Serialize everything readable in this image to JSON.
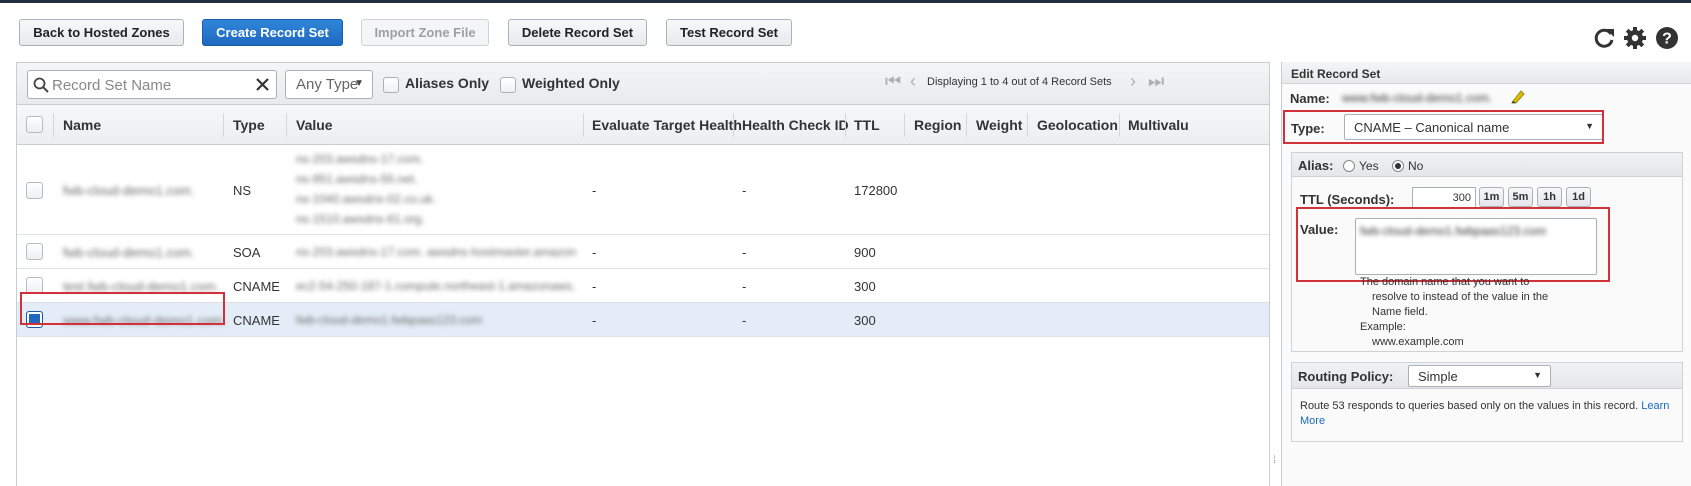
{
  "toolbar": {
    "back_label": "Back to Hosted Zones",
    "create_label": "Create Record Set",
    "import_label": "Import Zone File",
    "delete_label": "Delete Record Set",
    "test_label": "Test Record Set"
  },
  "filter": {
    "search_placeholder": "Record Set Name",
    "type_select": "Any Type",
    "aliases_only": "Aliases Only",
    "weighted_only": "Weighted Only",
    "pager_text": "Displaying 1 to 4 out of 4 Record Sets"
  },
  "columns": [
    "Name",
    "Type",
    "Value",
    "Evaluate Target Health",
    "Health Check ID",
    "TTL",
    "Region",
    "Weight",
    "Geolocation",
    "Multivalu"
  ],
  "rows": [
    {
      "name": "fwb-cloud-demo1.com.",
      "type": "NS",
      "values": [
        "ns-203.awsdns-17.com.",
        "ns-951.awsdns-55.net.",
        "ns-1040.awsdns-02.co.uk.",
        "ns-1510.awsdns-61.org."
      ],
      "evaluate": "-",
      "health": "-",
      "ttl": "172800"
    },
    {
      "name": "fwb-cloud-demo1.com.",
      "type": "SOA",
      "values": [
        "ns-203.awsdns-17.com. awsdns-hostmaster.amazon"
      ],
      "evaluate": "-",
      "health": "-",
      "ttl": "900"
    },
    {
      "name": "test.fwb-cloud-demo1.com.",
      "type": "CNAME",
      "values": [
        "ec2-54-250-187-1.compute.northeast-1.amazonaws.com"
      ],
      "evaluate": "-",
      "health": "-",
      "ttl": "300"
    },
    {
      "name": "www.fwb-cloud-demo1.com.",
      "type": "CNAME",
      "values": [
        "fwb-cloud-demo1.fwbpaas123.com"
      ],
      "evaluate": "-",
      "health": "-",
      "ttl": "300"
    }
  ],
  "edit": {
    "header": "Edit Record Set",
    "name_label": "Name:",
    "name_value": "www.fwb-cloud-demo1.com.",
    "type_label": "Type:",
    "type_value": "CNAME – Canonical name",
    "alias_label": "Alias:",
    "alias_yes": "Yes",
    "alias_no": "No",
    "ttl_label": "TTL (Seconds):",
    "ttl_value": "300",
    "ttl_buttons": [
      "1m",
      "5m",
      "1h",
      "1d"
    ],
    "value_label": "Value:",
    "value_text": "fwb-cloud-demo1.fwbpaas123.com",
    "help_lines": [
      "The domain name that you want to",
      "resolve to instead of the value in the",
      "Name field.",
      "Example:",
      "www.example.com"
    ],
    "routing_label": "Routing Policy:",
    "routing_value": "Simple",
    "routing_help": "Route 53 responds to queries based only on the values in this record.",
    "learn": "Learn",
    "more": "More"
  },
  "icons": [
    "refresh-icon",
    "gear-icon",
    "help-icon",
    "search-icon",
    "clear-icon",
    "pencil-icon"
  ],
  "colors": {
    "primary": "#1f69c0",
    "highlight": "#d13239",
    "selected_row": "#e4edf7"
  }
}
